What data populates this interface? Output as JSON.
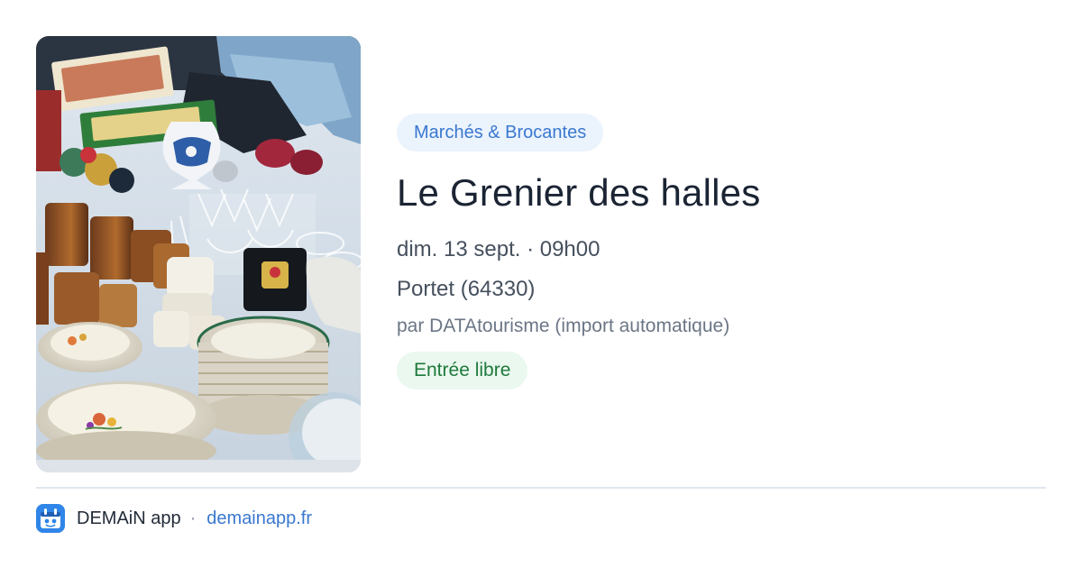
{
  "event": {
    "photo_alt": "Brocante: vaisselle, verres et objets anciens",
    "category": "Marchés & Brocantes",
    "title": "Le Grenier des halles",
    "datetime": "dim. 13 sept. · 09h00",
    "location": "Portet (64330)",
    "source": "par DATAtourisme (import automatique)",
    "price": "Entrée libre"
  },
  "footer": {
    "logo_icon": "app-logo-icon",
    "app_name": "DEMAiN app",
    "separator": "·",
    "url": "demainapp.fr"
  },
  "colors": {
    "category_text": "#3a78cf",
    "category_bg": "#ebf3fd",
    "price_text": "#1f7a3c",
    "price_bg": "#eaf8ef",
    "link": "#3a78cf",
    "logo_bg": "#2f86e8"
  }
}
